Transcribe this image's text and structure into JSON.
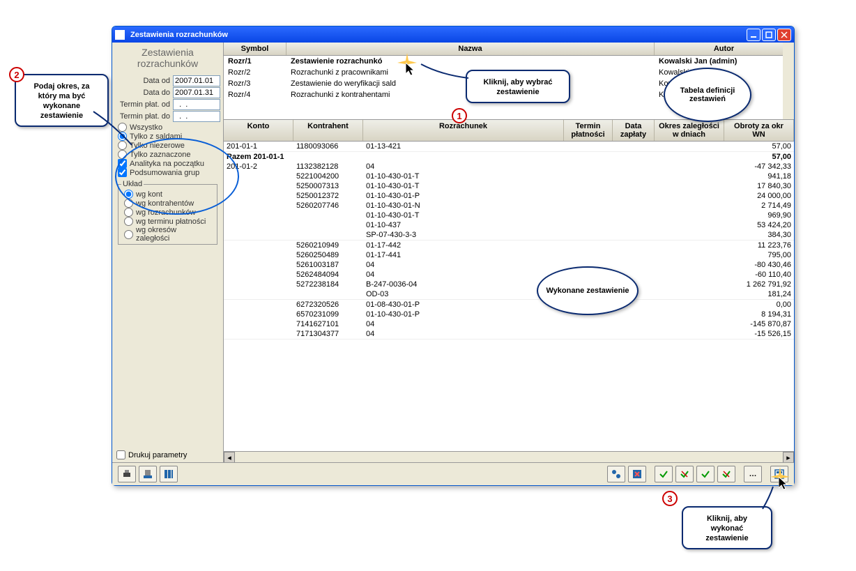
{
  "window": {
    "title": "Zestawienia rozrachunków"
  },
  "left": {
    "header": "Zestawienia rozrachunków",
    "data_od_lbl": "Data od",
    "data_od_val": "2007.01.01",
    "data_do_lbl": "Data do",
    "data_do_val": "2007.01.31",
    "tp_od_lbl": "Termin płat. od",
    "tp_od_val": "  .  .",
    "tp_do_lbl": "Termin płat. do",
    "tp_do_val": "  .  .",
    "r_wszystko": "Wszystko",
    "r_saldami": "Tylko z saldami",
    "r_niezer": "Tylko niezerowe",
    "r_zazn": "Tylko zaznaczone",
    "c_analit": "Analityka na początku",
    "c_pods": "Podsumowania grup",
    "uklad_legend": "Układ",
    "u_kont": "wg kont",
    "u_kontr": "wg kontrahentów",
    "u_rozr": "wg rozrachunków",
    "u_term": "wg terminu płatności",
    "u_okr": "wg okresów zaległości",
    "drukuj": "Drukuj parametry"
  },
  "def_hdr": {
    "symbol": "Symbol",
    "nazwa": "Nazwa",
    "autor": "Autor"
  },
  "def_rows": [
    {
      "symbol": "Rozr/1",
      "nazwa": "Zestawienie rozrachunkó",
      "autor": "Kowalski Jan (admin)",
      "sel": true
    },
    {
      "symbol": "Rozr/2",
      "nazwa": "Rozrachunki z pracownikami",
      "autor": "Kowalski Jan (",
      "sel": false
    },
    {
      "symbol": "Rozr/3",
      "nazwa": "Zestawienie do weryfikacji sald",
      "autor": "Kowalski Ja",
      "sel": false
    },
    {
      "symbol": "Rozr/4",
      "nazwa": "Rozrachunki z kontrahentami",
      "autor": "Kowalski Ja",
      "sel": false
    }
  ],
  "data_hdr": {
    "konto": "Konto",
    "kontrah": "Kontrahent",
    "rozr": "Rozrachunek",
    "tp": "Termin płatności",
    "dz": "Data zapłaty",
    "oz": "Okres zaległości w dniach",
    "ob": "Obroty za okr",
    "ob2": "WN"
  },
  "data_rows": [
    {
      "k": "201-01-1",
      "kh": "1180093066",
      "r": "01-13-421",
      "ob": "57,00"
    },
    {
      "k": "Razem 201-01-1",
      "kh": "",
      "r": "",
      "ob": "57,00",
      "bold": true,
      "nob": true,
      "colspan": true
    },
    {
      "k": "201-01-2",
      "kh": "1132382128",
      "r": "04",
      "ob": "-47 342,33",
      "nob": true
    },
    {
      "k": "",
      "kh": "5221004200",
      "r": "01-10-430-01-T",
      "ob": "941,18",
      "nob": true
    },
    {
      "k": "",
      "kh": "5250007313",
      "r": "01-10-430-01-T",
      "ob": "17 840,30",
      "nob": true
    },
    {
      "k": "",
      "kh": "5250012372",
      "r": "01-10-430-01-P",
      "ob": "24 000,00",
      "nob": true
    },
    {
      "k": "",
      "kh": "5260207746",
      "r": "01-10-430-01-N",
      "ob": "2 714,49",
      "nob": true
    },
    {
      "k": "",
      "kh": "",
      "r": "01-10-430-01-T",
      "ob": "969,90",
      "nob": true
    },
    {
      "k": "",
      "kh": "",
      "r": "01-10-437",
      "ob": "53 424,20",
      "nob": true
    },
    {
      "k": "",
      "kh": "",
      "r": "SP-07-430-3-3",
      "ob": "384,30"
    },
    {
      "k": "",
      "kh": "5260210949",
      "r": "01-17-442",
      "ob": "11 223,76",
      "nob": true
    },
    {
      "k": "",
      "kh": "5260250489",
      "r": "01-17-441",
      "ob": "795,00",
      "nob": true
    },
    {
      "k": "",
      "kh": "5261003187",
      "r": "04",
      "ob": "-80 430,46",
      "nob": true
    },
    {
      "k": "",
      "kh": "5262484094",
      "r": "04",
      "ob": "-60 110,40",
      "nob": true
    },
    {
      "k": "",
      "kh": "5272238184",
      "r": "B-247-0036-04",
      "ob": "1 262 791,92",
      "nob": true
    },
    {
      "k": "",
      "kh": "",
      "r": "OD-03",
      "ob": "181,24"
    },
    {
      "k": "",
      "kh": "6272320526",
      "r": "01-08-430-01-P",
      "ob": "0,00",
      "nob": true
    },
    {
      "k": "",
      "kh": "6570231099",
      "r": "01-10-430-01-P",
      "ob": "8 194,31",
      "nob": true
    },
    {
      "k": "",
      "kh": "7141627101",
      "r": "04",
      "ob": "-145 870,87",
      "nob": true
    },
    {
      "k": "",
      "kh": "7171304377",
      "r": "04",
      "ob": "-15 526,15"
    }
  ],
  "callouts": {
    "c1": "Kliknij, aby wybrać zestawienie",
    "c2": "Podaj okres, za który ma być wykonane zestawienie",
    "c3": "Kliknij, aby wykonać zestawienie",
    "o_top": "Tabela definicji zestawień",
    "o_mid": "Wykonane zestawienie"
  }
}
